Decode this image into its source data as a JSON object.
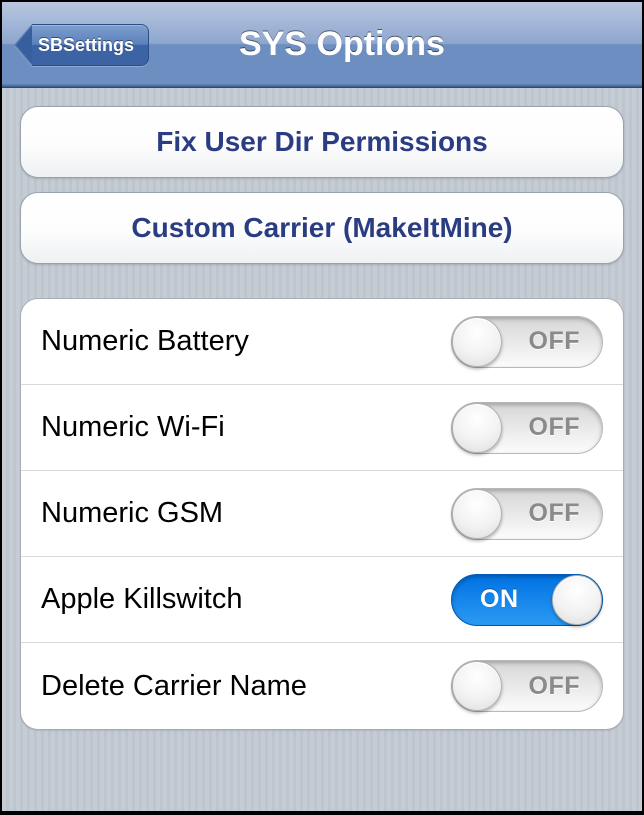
{
  "nav": {
    "back_label": "SBSettings",
    "title": "SYS Options"
  },
  "buttons": {
    "fix_permissions": "Fix User Dir Permissions",
    "custom_carrier": "Custom Carrier (MakeItMine)"
  },
  "toggle_labels": {
    "on": "ON",
    "off": "OFF"
  },
  "settings": [
    {
      "label": "Numeric Battery",
      "on": false
    },
    {
      "label": "Numeric Wi-Fi",
      "on": false
    },
    {
      "label": "Numeric GSM",
      "on": false
    },
    {
      "label": "Apple Killswitch",
      "on": true
    },
    {
      "label": "Delete Carrier Name",
      "on": false
    }
  ]
}
